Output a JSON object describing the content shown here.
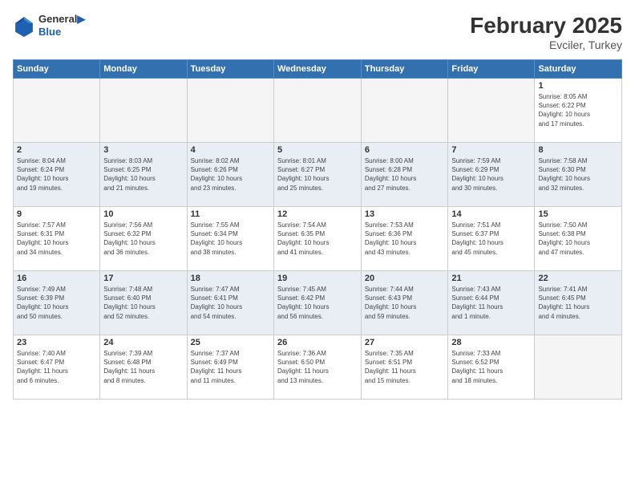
{
  "header": {
    "logo_line1": "General",
    "logo_line2": "Blue",
    "main_title": "February 2025",
    "subtitle": "Evciler, Turkey"
  },
  "days_of_week": [
    "Sunday",
    "Monday",
    "Tuesday",
    "Wednesday",
    "Thursday",
    "Friday",
    "Saturday"
  ],
  "weeks": [
    {
      "class": "week-row-1",
      "days": [
        {
          "num": "",
          "info": ""
        },
        {
          "num": "",
          "info": ""
        },
        {
          "num": "",
          "info": ""
        },
        {
          "num": "",
          "info": ""
        },
        {
          "num": "",
          "info": ""
        },
        {
          "num": "",
          "info": ""
        },
        {
          "num": "1",
          "info": "Sunrise: 8:05 AM\nSunset: 6:22 PM\nDaylight: 10 hours\nand 17 minutes."
        }
      ]
    },
    {
      "class": "week-row-2",
      "days": [
        {
          "num": "2",
          "info": "Sunrise: 8:04 AM\nSunset: 6:24 PM\nDaylight: 10 hours\nand 19 minutes."
        },
        {
          "num": "3",
          "info": "Sunrise: 8:03 AM\nSunset: 6:25 PM\nDaylight: 10 hours\nand 21 minutes."
        },
        {
          "num": "4",
          "info": "Sunrise: 8:02 AM\nSunset: 6:26 PM\nDaylight: 10 hours\nand 23 minutes."
        },
        {
          "num": "5",
          "info": "Sunrise: 8:01 AM\nSunset: 6:27 PM\nDaylight: 10 hours\nand 25 minutes."
        },
        {
          "num": "6",
          "info": "Sunrise: 8:00 AM\nSunset: 6:28 PM\nDaylight: 10 hours\nand 27 minutes."
        },
        {
          "num": "7",
          "info": "Sunrise: 7:59 AM\nSunset: 6:29 PM\nDaylight: 10 hours\nand 30 minutes."
        },
        {
          "num": "8",
          "info": "Sunrise: 7:58 AM\nSunset: 6:30 PM\nDaylight: 10 hours\nand 32 minutes."
        }
      ]
    },
    {
      "class": "week-row-3",
      "days": [
        {
          "num": "9",
          "info": "Sunrise: 7:57 AM\nSunset: 6:31 PM\nDaylight: 10 hours\nand 34 minutes."
        },
        {
          "num": "10",
          "info": "Sunrise: 7:56 AM\nSunset: 6:32 PM\nDaylight: 10 hours\nand 36 minutes."
        },
        {
          "num": "11",
          "info": "Sunrise: 7:55 AM\nSunset: 6:34 PM\nDaylight: 10 hours\nand 38 minutes."
        },
        {
          "num": "12",
          "info": "Sunrise: 7:54 AM\nSunset: 6:35 PM\nDaylight: 10 hours\nand 41 minutes."
        },
        {
          "num": "13",
          "info": "Sunrise: 7:53 AM\nSunset: 6:36 PM\nDaylight: 10 hours\nand 43 minutes."
        },
        {
          "num": "14",
          "info": "Sunrise: 7:51 AM\nSunset: 6:37 PM\nDaylight: 10 hours\nand 45 minutes."
        },
        {
          "num": "15",
          "info": "Sunrise: 7:50 AM\nSunset: 6:38 PM\nDaylight: 10 hours\nand 47 minutes."
        }
      ]
    },
    {
      "class": "week-row-4",
      "days": [
        {
          "num": "16",
          "info": "Sunrise: 7:49 AM\nSunset: 6:39 PM\nDaylight: 10 hours\nand 50 minutes."
        },
        {
          "num": "17",
          "info": "Sunrise: 7:48 AM\nSunset: 6:40 PM\nDaylight: 10 hours\nand 52 minutes."
        },
        {
          "num": "18",
          "info": "Sunrise: 7:47 AM\nSunset: 6:41 PM\nDaylight: 10 hours\nand 54 minutes."
        },
        {
          "num": "19",
          "info": "Sunrise: 7:45 AM\nSunset: 6:42 PM\nDaylight: 10 hours\nand 56 minutes."
        },
        {
          "num": "20",
          "info": "Sunrise: 7:44 AM\nSunset: 6:43 PM\nDaylight: 10 hours\nand 59 minutes."
        },
        {
          "num": "21",
          "info": "Sunrise: 7:43 AM\nSunset: 6:44 PM\nDaylight: 11 hours\nand 1 minute."
        },
        {
          "num": "22",
          "info": "Sunrise: 7:41 AM\nSunset: 6:45 PM\nDaylight: 11 hours\nand 4 minutes."
        }
      ]
    },
    {
      "class": "week-row-5",
      "days": [
        {
          "num": "23",
          "info": "Sunrise: 7:40 AM\nSunset: 6:47 PM\nDaylight: 11 hours\nand 6 minutes."
        },
        {
          "num": "24",
          "info": "Sunrise: 7:39 AM\nSunset: 6:48 PM\nDaylight: 11 hours\nand 8 minutes."
        },
        {
          "num": "25",
          "info": "Sunrise: 7:37 AM\nSunset: 6:49 PM\nDaylight: 11 hours\nand 11 minutes."
        },
        {
          "num": "26",
          "info": "Sunrise: 7:36 AM\nSunset: 6:50 PM\nDaylight: 11 hours\nand 13 minutes."
        },
        {
          "num": "27",
          "info": "Sunrise: 7:35 AM\nSunset: 6:51 PM\nDaylight: 11 hours\nand 15 minutes."
        },
        {
          "num": "28",
          "info": "Sunrise: 7:33 AM\nSunset: 6:52 PM\nDaylight: 11 hours\nand 18 minutes."
        },
        {
          "num": "",
          "info": ""
        }
      ]
    }
  ]
}
